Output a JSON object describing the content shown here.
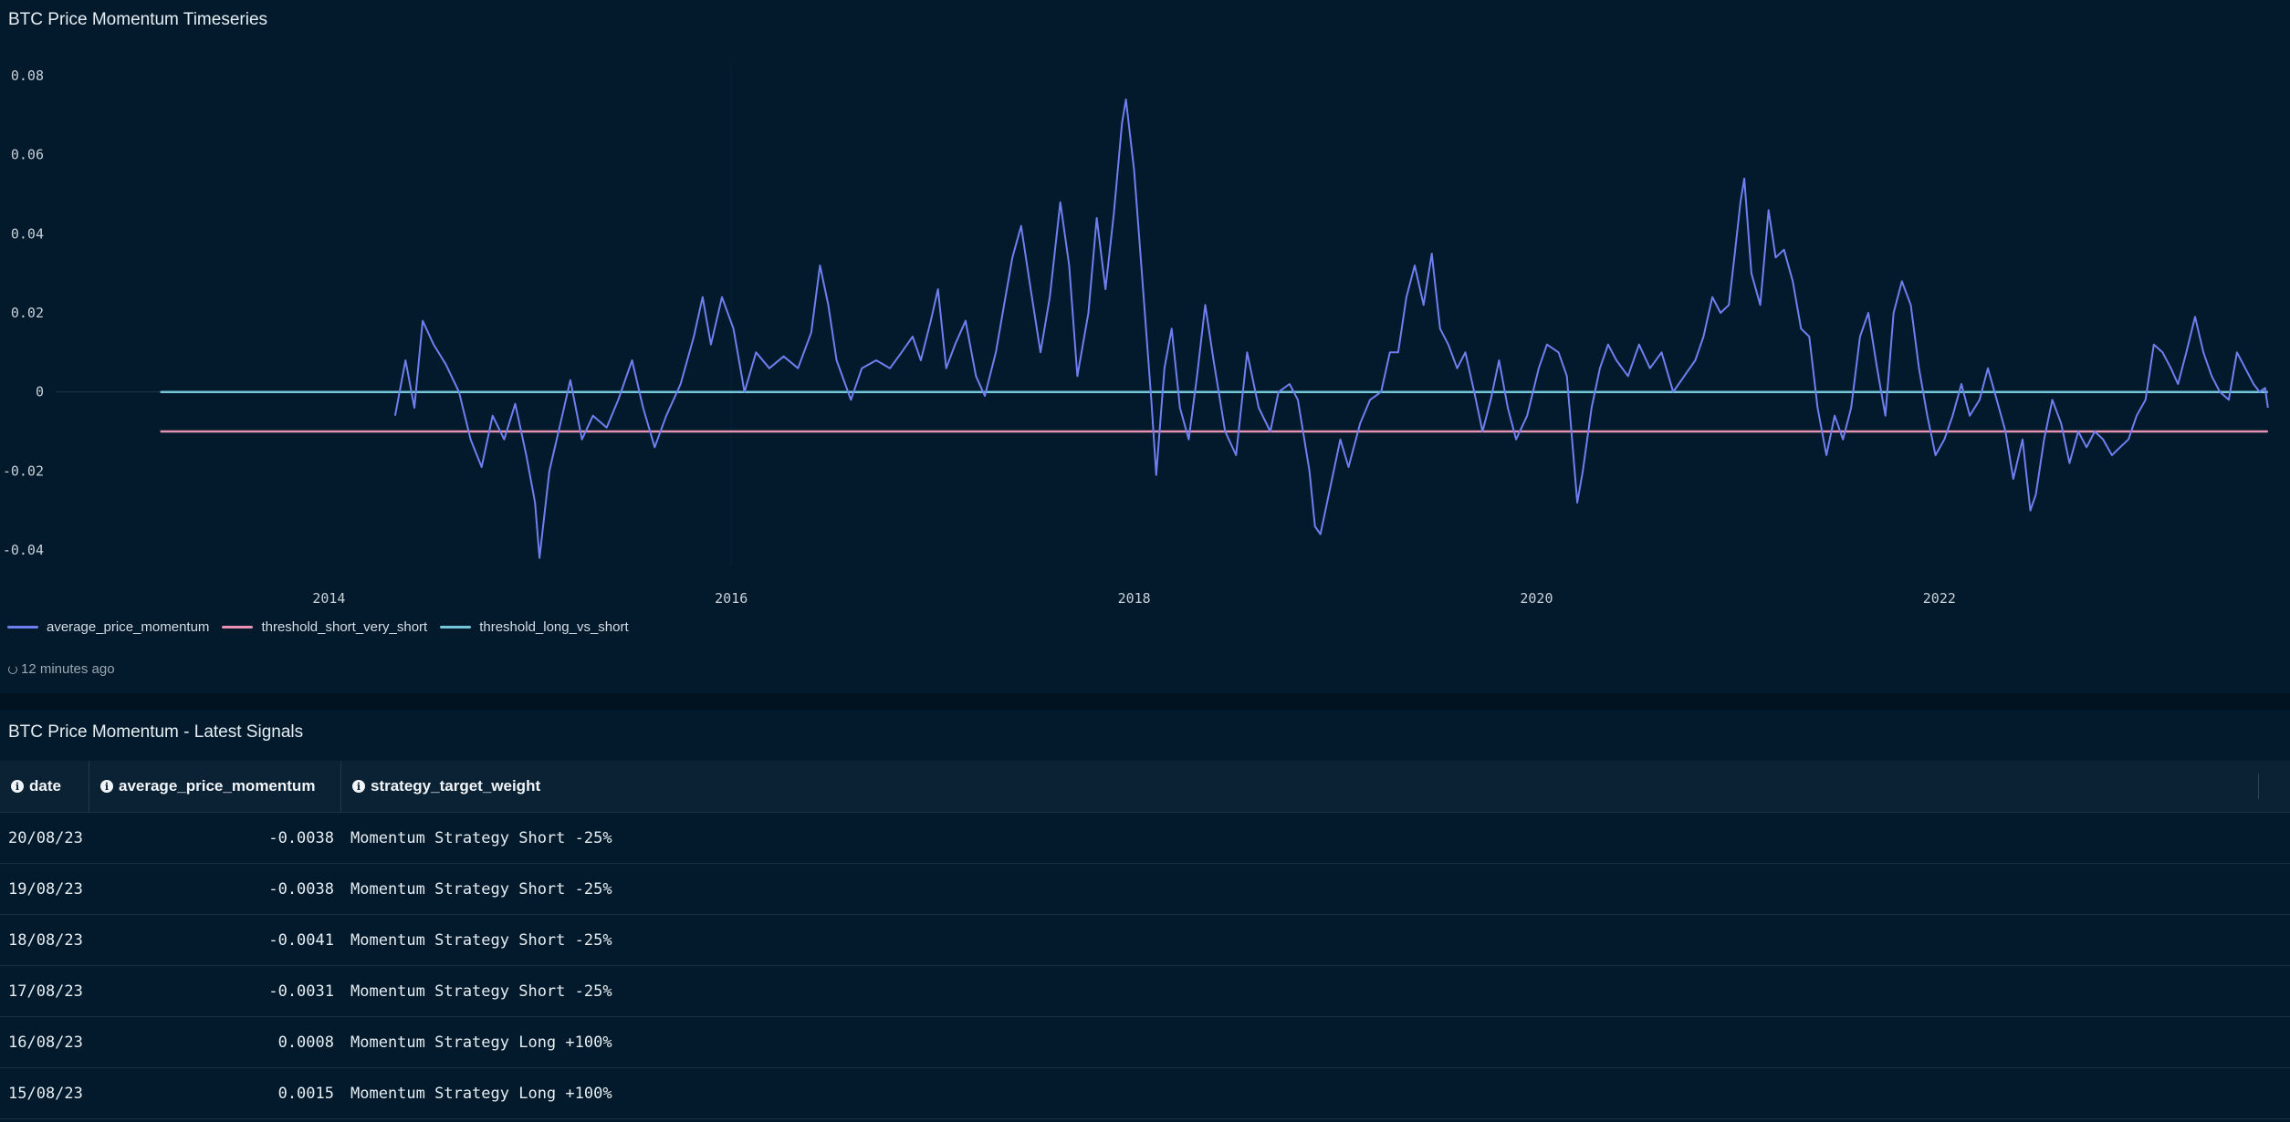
{
  "chart_panel": {
    "title": "BTC Price Momentum Timeseries",
    "updated": "12 minutes ago"
  },
  "chart_data": {
    "type": "line",
    "title": "BTC Price Momentum Timeseries",
    "xlabel": "",
    "ylabel": "",
    "x_ticks": [
      "2014",
      "2016",
      "2018",
      "2020",
      "2022"
    ],
    "y_ticks": [
      "0.08",
      "0.06",
      "0.04",
      "0.02",
      "0",
      "-0.02",
      "-0.04"
    ],
    "xlim": [
      "2013-01-01",
      "2023-09-01"
    ],
    "ylim": [
      -0.045,
      0.085
    ],
    "grid": false,
    "legend_position": "bottom-left",
    "series": [
      {
        "name": "average_price_momentum",
        "color": "#6f7ff0",
        "points": [
          [
            "2014-05-01",
            -0.006
          ],
          [
            "2014-05-20",
            0.008
          ],
          [
            "2014-06-05",
            -0.004
          ],
          [
            "2014-06-20",
            0.018
          ],
          [
            "2014-07-10",
            0.012
          ],
          [
            "2014-08-01",
            0.007
          ],
          [
            "2014-08-25",
            0.0
          ],
          [
            "2014-09-15",
            -0.012
          ],
          [
            "2014-10-05",
            -0.019
          ],
          [
            "2014-10-25",
            -0.006
          ],
          [
            "2014-11-15",
            -0.012
          ],
          [
            "2014-12-05",
            -0.003
          ],
          [
            "2014-12-25",
            -0.016
          ],
          [
            "2015-01-10",
            -0.028
          ],
          [
            "2015-01-18",
            -0.042
          ],
          [
            "2015-02-05",
            -0.02
          ],
          [
            "2015-02-25",
            -0.008
          ],
          [
            "2015-03-15",
            0.003
          ],
          [
            "2015-04-05",
            -0.012
          ],
          [
            "2015-04-25",
            -0.006
          ],
          [
            "2015-05-20",
            -0.009
          ],
          [
            "2015-06-10",
            -0.002
          ],
          [
            "2015-07-05",
            0.008
          ],
          [
            "2015-07-25",
            -0.004
          ],
          [
            "2015-08-15",
            -0.014
          ],
          [
            "2015-09-05",
            -0.006
          ],
          [
            "2015-10-01",
            0.002
          ],
          [
            "2015-10-25",
            0.014
          ],
          [
            "2015-11-10",
            0.024
          ],
          [
            "2015-11-25",
            0.012
          ],
          [
            "2015-12-15",
            0.024
          ],
          [
            "2016-01-05",
            0.016
          ],
          [
            "2016-01-25",
            0.0
          ],
          [
            "2016-02-15",
            0.01
          ],
          [
            "2016-03-10",
            0.006
          ],
          [
            "2016-04-05",
            0.009
          ],
          [
            "2016-05-01",
            0.006
          ],
          [
            "2016-05-25",
            0.015
          ],
          [
            "2016-06-10",
            0.032
          ],
          [
            "2016-06-25",
            0.022
          ],
          [
            "2016-07-10",
            0.008
          ],
          [
            "2016-08-05",
            -0.002
          ],
          [
            "2016-08-25",
            0.006
          ],
          [
            "2016-09-20",
            0.008
          ],
          [
            "2016-10-15",
            0.006
          ],
          [
            "2016-11-05",
            0.01
          ],
          [
            "2016-11-25",
            0.014
          ],
          [
            "2016-12-10",
            0.008
          ],
          [
            "2016-12-28",
            0.018
          ],
          [
            "2017-01-10",
            0.026
          ],
          [
            "2017-01-25",
            0.006
          ],
          [
            "2017-02-10",
            0.012
          ],
          [
            "2017-03-01",
            0.018
          ],
          [
            "2017-03-20",
            0.004
          ],
          [
            "2017-04-05",
            -0.001
          ],
          [
            "2017-04-25",
            0.01
          ],
          [
            "2017-05-10",
            0.022
          ],
          [
            "2017-05-25",
            0.034
          ],
          [
            "2017-06-10",
            0.042
          ],
          [
            "2017-06-25",
            0.028
          ],
          [
            "2017-07-15",
            0.01
          ],
          [
            "2017-08-01",
            0.024
          ],
          [
            "2017-08-20",
            0.048
          ],
          [
            "2017-09-05",
            0.032
          ],
          [
            "2017-09-20",
            0.004
          ],
          [
            "2017-10-10",
            0.02
          ],
          [
            "2017-10-25",
            0.044
          ],
          [
            "2017-11-10",
            0.026
          ],
          [
            "2017-11-25",
            0.045
          ],
          [
            "2017-12-10",
            0.068
          ],
          [
            "2017-12-17",
            0.074
          ],
          [
            "2018-01-01",
            0.056
          ],
          [
            "2018-01-15",
            0.03
          ],
          [
            "2018-02-01",
            -0.002
          ],
          [
            "2018-02-10",
            -0.021
          ],
          [
            "2018-02-25",
            0.006
          ],
          [
            "2018-03-10",
            0.016
          ],
          [
            "2018-03-25",
            -0.004
          ],
          [
            "2018-04-10",
            -0.012
          ],
          [
            "2018-04-25",
            0.004
          ],
          [
            "2018-05-10",
            0.022
          ],
          [
            "2018-05-25",
            0.008
          ],
          [
            "2018-06-15",
            -0.01
          ],
          [
            "2018-07-05",
            -0.016
          ],
          [
            "2018-07-25",
            0.01
          ],
          [
            "2018-08-15",
            -0.004
          ],
          [
            "2018-09-05",
            -0.01
          ],
          [
            "2018-09-20",
            0.0
          ],
          [
            "2018-10-10",
            0.002
          ],
          [
            "2018-10-25",
            -0.002
          ],
          [
            "2018-11-15",
            -0.02
          ],
          [
            "2018-11-25",
            -0.034
          ],
          [
            "2018-12-05",
            -0.036
          ],
          [
            "2018-12-20",
            -0.026
          ],
          [
            "2019-01-10",
            -0.012
          ],
          [
            "2019-01-25",
            -0.019
          ],
          [
            "2019-02-15",
            -0.008
          ],
          [
            "2019-03-05",
            -0.002
          ],
          [
            "2019-03-25",
            0.0
          ],
          [
            "2019-04-10",
            0.01
          ],
          [
            "2019-04-25",
            0.01
          ],
          [
            "2019-05-10",
            0.024
          ],
          [
            "2019-05-25",
            0.032
          ],
          [
            "2019-06-10",
            0.022
          ],
          [
            "2019-06-25",
            0.035
          ],
          [
            "2019-07-10",
            0.016
          ],
          [
            "2019-07-25",
            0.012
          ],
          [
            "2019-08-10",
            0.006
          ],
          [
            "2019-08-25",
            0.01
          ],
          [
            "2019-09-10",
            0.0
          ],
          [
            "2019-09-25",
            -0.01
          ],
          [
            "2019-10-10",
            -0.002
          ],
          [
            "2019-10-25",
            0.008
          ],
          [
            "2019-11-10",
            -0.004
          ],
          [
            "2019-11-25",
            -0.012
          ],
          [
            "2019-12-15",
            -0.006
          ],
          [
            "2020-01-05",
            0.006
          ],
          [
            "2020-01-20",
            0.012
          ],
          [
            "2020-02-10",
            0.01
          ],
          [
            "2020-02-25",
            0.004
          ],
          [
            "2020-03-15",
            -0.028
          ],
          [
            "2020-03-25",
            -0.02
          ],
          [
            "2020-04-10",
            -0.004
          ],
          [
            "2020-04-25",
            0.006
          ],
          [
            "2020-05-10",
            0.012
          ],
          [
            "2020-05-25",
            0.008
          ],
          [
            "2020-06-15",
            0.004
          ],
          [
            "2020-07-05",
            0.012
          ],
          [
            "2020-07-25",
            0.006
          ],
          [
            "2020-08-15",
            0.01
          ],
          [
            "2020-09-05",
            0.0
          ],
          [
            "2020-09-25",
            0.004
          ],
          [
            "2020-10-15",
            0.008
          ],
          [
            "2020-10-30",
            0.014
          ],
          [
            "2020-11-15",
            0.024
          ],
          [
            "2020-11-30",
            0.02
          ],
          [
            "2020-12-15",
            0.022
          ],
          [
            "2020-12-25",
            0.034
          ],
          [
            "2021-01-05",
            0.048
          ],
          [
            "2021-01-12",
            0.054
          ],
          [
            "2021-01-25",
            0.03
          ],
          [
            "2021-02-10",
            0.022
          ],
          [
            "2021-02-25",
            0.046
          ],
          [
            "2021-03-10",
            0.034
          ],
          [
            "2021-03-25",
            0.036
          ],
          [
            "2021-04-10",
            0.028
          ],
          [
            "2021-04-25",
            0.016
          ],
          [
            "2021-05-10",
            0.014
          ],
          [
            "2021-05-25",
            -0.004
          ],
          [
            "2021-06-10",
            -0.016
          ],
          [
            "2021-06-25",
            -0.006
          ],
          [
            "2021-07-10",
            -0.012
          ],
          [
            "2021-07-25",
            -0.004
          ],
          [
            "2021-08-10",
            0.014
          ],
          [
            "2021-08-25",
            0.02
          ],
          [
            "2021-09-10",
            0.006
          ],
          [
            "2021-09-25",
            -0.006
          ],
          [
            "2021-10-10",
            0.02
          ],
          [
            "2021-10-25",
            0.028
          ],
          [
            "2021-11-10",
            0.022
          ],
          [
            "2021-11-25",
            0.006
          ],
          [
            "2021-12-10",
            -0.006
          ],
          [
            "2021-12-25",
            -0.016
          ],
          [
            "2022-01-10",
            -0.012
          ],
          [
            "2022-01-25",
            -0.006
          ],
          [
            "2022-02-10",
            0.002
          ],
          [
            "2022-02-25",
            -0.006
          ],
          [
            "2022-03-15",
            -0.002
          ],
          [
            "2022-03-30",
            0.006
          ],
          [
            "2022-04-15",
            -0.002
          ],
          [
            "2022-05-01",
            -0.01
          ],
          [
            "2022-05-15",
            -0.022
          ],
          [
            "2022-06-01",
            -0.012
          ],
          [
            "2022-06-15",
            -0.03
          ],
          [
            "2022-06-25",
            -0.026
          ],
          [
            "2022-07-10",
            -0.012
          ],
          [
            "2022-07-25",
            -0.002
          ],
          [
            "2022-08-10",
            -0.008
          ],
          [
            "2022-08-25",
            -0.018
          ],
          [
            "2022-09-10",
            -0.01
          ],
          [
            "2022-09-25",
            -0.014
          ],
          [
            "2022-10-10",
            -0.01
          ],
          [
            "2022-10-25",
            -0.012
          ],
          [
            "2022-11-10",
            -0.016
          ],
          [
            "2022-11-25",
            -0.014
          ],
          [
            "2022-12-10",
            -0.012
          ],
          [
            "2022-12-25",
            -0.006
          ],
          [
            "2023-01-10",
            -0.002
          ],
          [
            "2023-01-25",
            0.012
          ],
          [
            "2023-02-10",
            0.01
          ],
          [
            "2023-02-25",
            0.006
          ],
          [
            "2023-03-10",
            0.002
          ],
          [
            "2023-03-25",
            0.01
          ],
          [
            "2023-04-10",
            0.019
          ],
          [
            "2023-04-25",
            0.01
          ],
          [
            "2023-05-10",
            0.004
          ],
          [
            "2023-05-25",
            0.0
          ],
          [
            "2023-06-10",
            -0.002
          ],
          [
            "2023-06-25",
            0.01
          ],
          [
            "2023-07-10",
            0.006
          ],
          [
            "2023-07-25",
            0.002
          ],
          [
            "2023-08-05",
            0.0
          ],
          [
            "2023-08-15",
            0.001
          ],
          [
            "2023-08-20",
            -0.004
          ]
        ]
      },
      {
        "name": "threshold_short_very_short",
        "color": "#e891b2",
        "points": [
          [
            "2013-03-01",
            -0.01
          ],
          [
            "2023-08-20",
            -0.01
          ]
        ]
      },
      {
        "name": "threshold_long_vs_short",
        "color": "#74c7d8",
        "points": [
          [
            "2013-03-01",
            0.0
          ],
          [
            "2023-08-20",
            0.0
          ]
        ]
      }
    ]
  },
  "table_panel": {
    "title": "BTC Price Momentum - Latest Signals",
    "columns": [
      "date",
      "average_price_momentum",
      "strategy_target_weight"
    ],
    "rows": [
      {
        "date": "20/08/23",
        "average_price_momentum": "-0.0038",
        "strategy_target_weight": "Momentum Strategy Short -25%"
      },
      {
        "date": "19/08/23",
        "average_price_momentum": "-0.0038",
        "strategy_target_weight": "Momentum Strategy Short -25%"
      },
      {
        "date": "18/08/23",
        "average_price_momentum": "-0.0041",
        "strategy_target_weight": "Momentum Strategy Short -25%"
      },
      {
        "date": "17/08/23",
        "average_price_momentum": "-0.0031",
        "strategy_target_weight": "Momentum Strategy Short -25%"
      },
      {
        "date": "16/08/23",
        "average_price_momentum": "0.0008",
        "strategy_target_weight": "Momentum Strategy Long +100%"
      },
      {
        "date": "15/08/23",
        "average_price_momentum": "0.0015",
        "strategy_target_weight": "Momentum Strategy Long +100%"
      }
    ]
  },
  "colors": {
    "background": "#011627",
    "panel": "#021a2b",
    "axis_text": "#c8d0da"
  }
}
